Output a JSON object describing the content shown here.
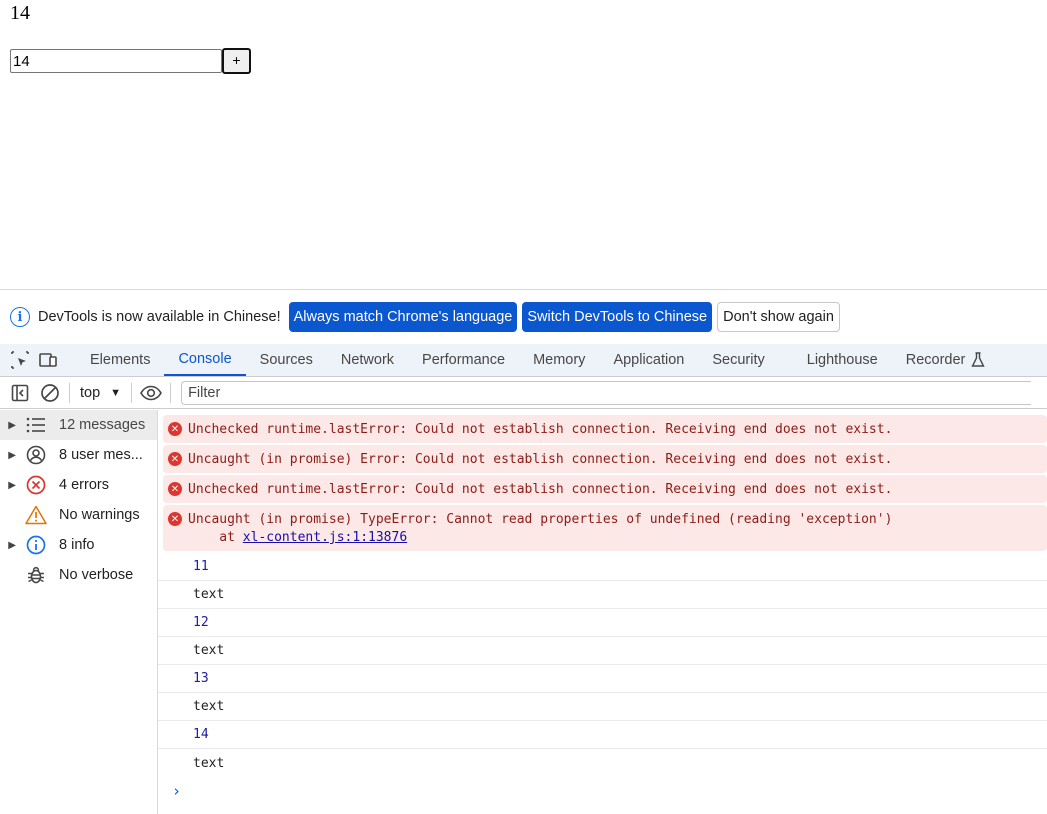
{
  "page": {
    "counter_text": "14",
    "input_value": "14",
    "plus_label": "+"
  },
  "infobar": {
    "message": "DevTools is now available in Chinese!",
    "btn_match": "Always match Chrome's language",
    "btn_switch": "Switch DevTools to Chinese",
    "btn_dismiss": "Don't show again"
  },
  "tabs": [
    "Elements",
    "Console",
    "Sources",
    "Network",
    "Performance",
    "Memory",
    "Application",
    "Security",
    "Lighthouse",
    "Recorder"
  ],
  "active_tab": "Console",
  "filterbar": {
    "context": "top",
    "filter_placeholder": "Filter"
  },
  "sidebar": {
    "items": [
      {
        "label": "12 messages",
        "icon": "list-icon",
        "expandable": true
      },
      {
        "label": "8 user mes...",
        "icon": "user-icon",
        "expandable": true
      },
      {
        "label": "4 errors",
        "icon": "error-icon",
        "expandable": true
      },
      {
        "label": "No warnings",
        "icon": "warning-icon",
        "expandable": false
      },
      {
        "label": "8 info",
        "icon": "info-icon",
        "expandable": true
      },
      {
        "label": "No verbose",
        "icon": "bug-icon",
        "expandable": false
      }
    ]
  },
  "console": {
    "errors": [
      {
        "text": "Unchecked runtime.lastError: Could not establish connection. Receiving end does not exist."
      },
      {
        "text": "Uncaught (in promise) Error: Could not establish connection. Receiving end does not exist."
      },
      {
        "text": "Unchecked runtime.lastError: Could not establish connection. Receiving end does not exist."
      },
      {
        "text": "Uncaught (in promise) TypeError: Cannot read properties of undefined (reading 'exception')",
        "stack_prefix": "    at ",
        "stack_link": "xl-content.js:1:13876"
      }
    ],
    "logs": [
      {
        "text": "11",
        "kind": "number"
      },
      {
        "text": "text",
        "kind": "string"
      },
      {
        "text": "12",
        "kind": "number"
      },
      {
        "text": "text",
        "kind": "string"
      },
      {
        "text": "13",
        "kind": "number"
      },
      {
        "text": "text",
        "kind": "string"
      },
      {
        "text": "14",
        "kind": "number"
      },
      {
        "text": "text",
        "kind": "string"
      }
    ],
    "prompt": "›"
  },
  "colors": {
    "accent": "#0b57d0",
    "error_bg": "#fce8e6",
    "error_icon": "#dc362e",
    "number_log": "#1a1aa6"
  }
}
